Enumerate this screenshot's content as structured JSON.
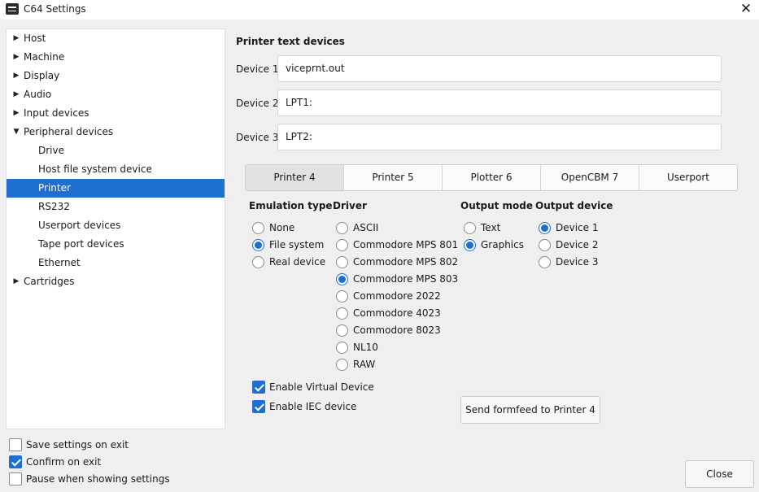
{
  "window": {
    "title": "C64 Settings"
  },
  "tree": [
    {
      "label": "Host",
      "arrow": "▶",
      "level": 0,
      "selected": false
    },
    {
      "label": "Machine",
      "arrow": "▶",
      "level": 0,
      "selected": false
    },
    {
      "label": "Display",
      "arrow": "▶",
      "level": 0,
      "selected": false
    },
    {
      "label": "Audio",
      "arrow": "▶",
      "level": 0,
      "selected": false
    },
    {
      "label": "Input devices",
      "arrow": "▶",
      "level": 0,
      "selected": false
    },
    {
      "label": "Peripheral devices",
      "arrow": "▼",
      "level": 0,
      "selected": false
    },
    {
      "label": "Drive",
      "arrow": "",
      "level": 1,
      "selected": false
    },
    {
      "label": "Host file system device",
      "arrow": "",
      "level": 1,
      "selected": false
    },
    {
      "label": "Printer",
      "arrow": "",
      "level": 1,
      "selected": true
    },
    {
      "label": "RS232",
      "arrow": "",
      "level": 1,
      "selected": false
    },
    {
      "label": "Userport devices",
      "arrow": "",
      "level": 1,
      "selected": false
    },
    {
      "label": "Tape port devices",
      "arrow": "",
      "level": 1,
      "selected": false
    },
    {
      "label": "Ethernet",
      "arrow": "",
      "level": 1,
      "selected": false
    },
    {
      "label": "Cartridges",
      "arrow": "▶",
      "level": 0,
      "selected": false
    }
  ],
  "printer_text": {
    "title": "Printer text devices",
    "devices": [
      {
        "label": "Device 1",
        "value": "viceprnt.out"
      },
      {
        "label": "Device 2",
        "value": "LPT1:"
      },
      {
        "label": "Device 3",
        "value": "LPT2:"
      }
    ]
  },
  "tabs": [
    "Printer 4",
    "Printer 5",
    "Plotter 6",
    "OpenCBM 7",
    "Userport"
  ],
  "emulation": {
    "heading": "Emulation type",
    "options": [
      {
        "label": "None",
        "checked": false
      },
      {
        "label": "File system",
        "checked": true
      },
      {
        "label": "Real device",
        "checked": false
      }
    ]
  },
  "driver": {
    "heading": "Driver",
    "options": [
      {
        "label": "ASCII",
        "checked": false
      },
      {
        "label": "Commodore MPS 801",
        "checked": false
      },
      {
        "label": "Commodore MPS 802",
        "checked": false
      },
      {
        "label": "Commodore MPS 803",
        "checked": true
      },
      {
        "label": "Commodore 2022",
        "checked": false
      },
      {
        "label": "Commodore 4023",
        "checked": false
      },
      {
        "label": "Commodore 8023",
        "checked": false
      },
      {
        "label": "NL10",
        "checked": false
      },
      {
        "label": "RAW",
        "checked": false
      }
    ]
  },
  "output_mode": {
    "heading": "Output mode",
    "options": [
      {
        "label": "Text",
        "checked": false
      },
      {
        "label": "Graphics",
        "checked": true
      }
    ]
  },
  "output_device": {
    "heading": "Output device",
    "options": [
      {
        "label": "Device 1",
        "checked": true
      },
      {
        "label": "Device 2",
        "checked": false
      },
      {
        "label": "Device 3",
        "checked": false
      }
    ]
  },
  "checkboxes": {
    "virtual": {
      "label": "Enable Virtual Device",
      "checked": true
    },
    "iec": {
      "label": "Enable IEC device",
      "checked": true
    }
  },
  "formfeed_button": "Send formfeed to Printer 4",
  "footer": {
    "save": {
      "label": "Save settings on exit",
      "checked": false
    },
    "confirm": {
      "label": "Confirm on exit",
      "checked": true
    },
    "pause": {
      "label": "Pause when showing settings",
      "checked": false
    },
    "close_button": "Close"
  },
  "colors": {
    "accent": "#1f6fd1",
    "background": "#efefef"
  }
}
